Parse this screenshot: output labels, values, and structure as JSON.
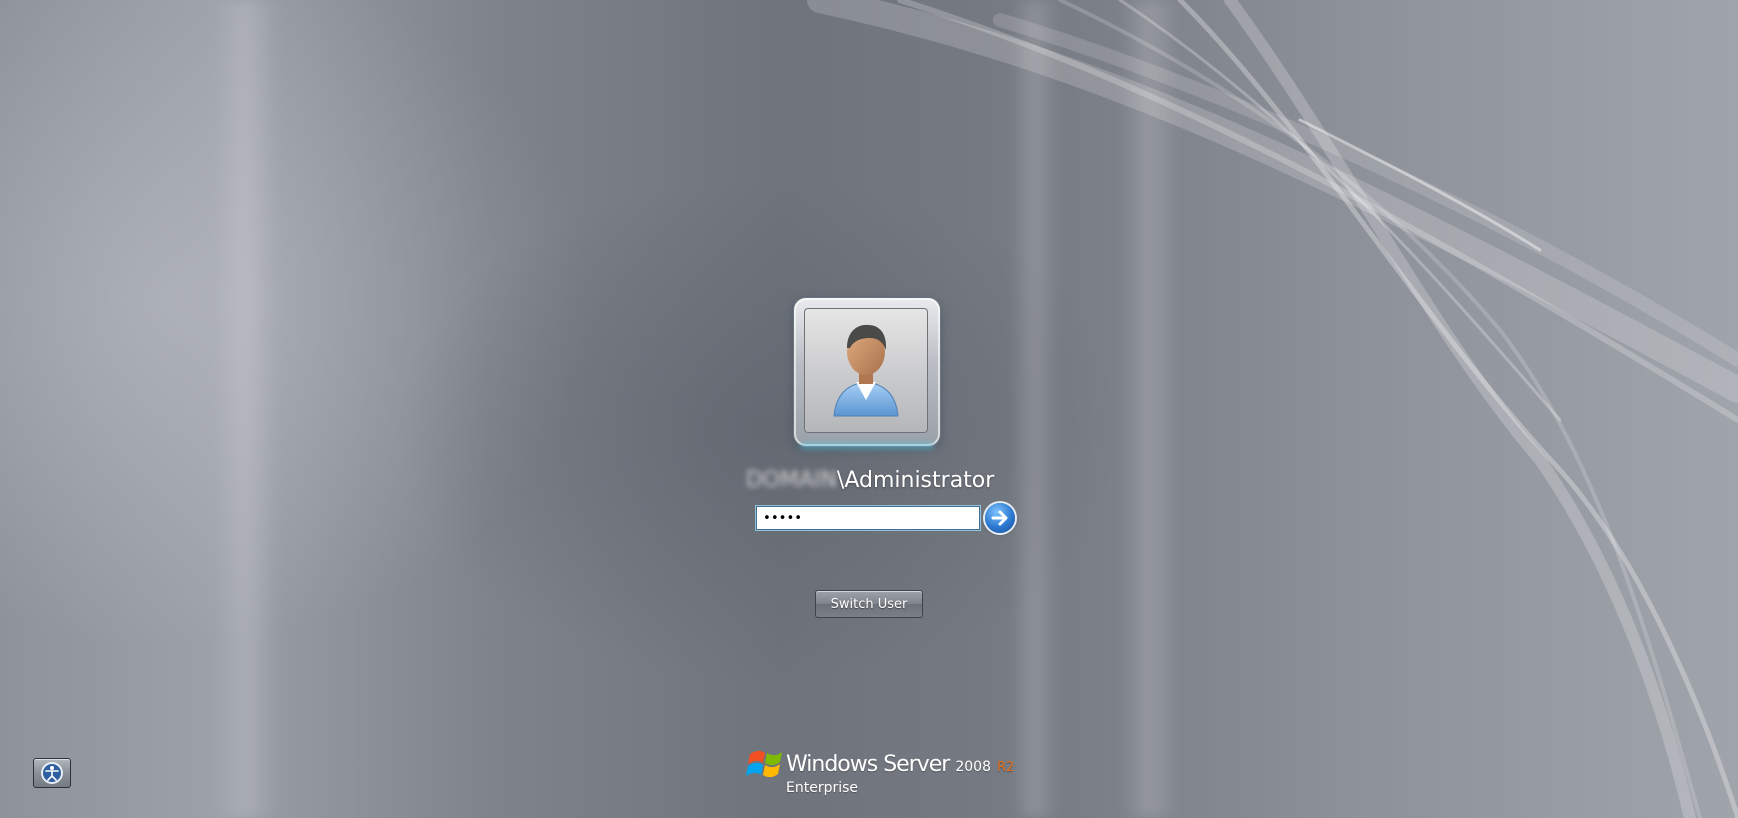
{
  "login": {
    "domain_redacted": "DOMAIN",
    "username_suffix": "\\Administrator",
    "password_masked": "•••••"
  },
  "buttons": {
    "switch_user_label": "Switch User"
  },
  "branding": {
    "product_name": "Windows Server",
    "version": "2008",
    "release": "R2",
    "edition": "Enterprise"
  },
  "colors": {
    "background": "#8a8f97",
    "accent_blue": "#2b79d1",
    "release_orange": "#e07020",
    "tile_glow": "#58c8e6"
  },
  "icons": {
    "user_avatar": "user-avatar-icon",
    "submit": "arrow-right-icon",
    "ease_of_access": "ease-of-access-icon",
    "logo": "windows-flag-icon"
  }
}
